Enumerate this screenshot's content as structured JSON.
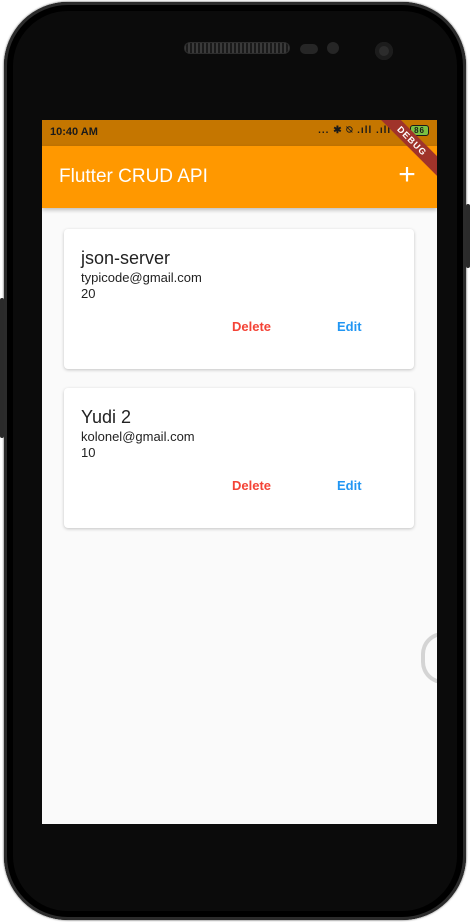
{
  "status_bar": {
    "time": "10:40 AM",
    "icons": "... ✱ ⍉ .ıll .ıll ≋",
    "battery": "86"
  },
  "app_bar": {
    "title": "Flutter CRUD API",
    "add_icon": "plus-icon",
    "add_glyph": "+",
    "debug_banner": "DEBUG"
  },
  "cards": [
    {
      "name": "json-server",
      "email": "typicode@gmail.com",
      "age": "20",
      "delete_label": "Delete",
      "edit_label": "Edit"
    },
    {
      "name": "Yudi 2",
      "email": "kolonel@gmail.com",
      "age": "10",
      "delete_label": "Delete",
      "edit_label": "Edit"
    }
  ],
  "colors": {
    "app_bar": "#ff9800",
    "status_bar": "#c57600",
    "delete": "#f44336",
    "edit": "#2196f3",
    "debug_banner": "#a0332a"
  }
}
